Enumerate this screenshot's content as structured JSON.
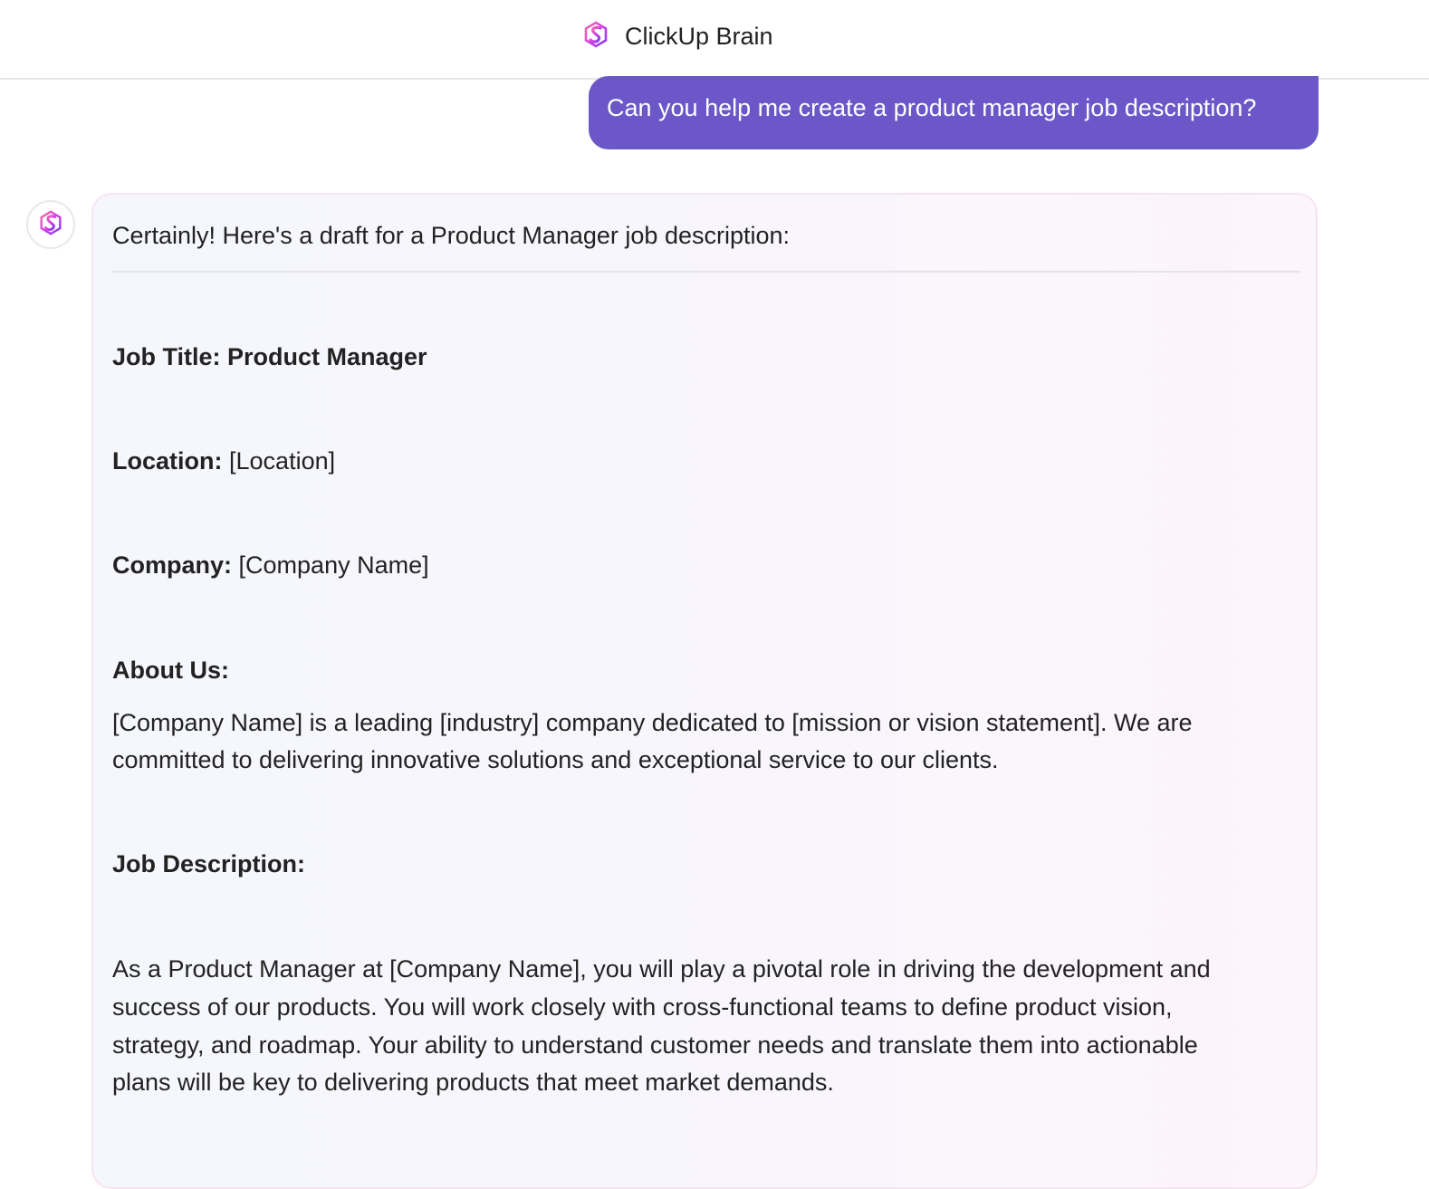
{
  "header": {
    "title": "ClickUp Brain",
    "icon": "brain-logo-icon"
  },
  "conversation": {
    "user_message": "Can you help me create a product manager job description?",
    "assistant": {
      "intro": "Certainly! Here's a draft for a Product Manager job description:",
      "job_title_label": "Job Title: Product Manager",
      "location_label": "Location:",
      "location_value": "[Location]",
      "company_label": "Company:",
      "company_value": "[Company Name]",
      "about_label": "About Us:",
      "about_lines": [
        "[Company Name] is a leading [industry] company dedicated to [mission or vision statement]. We are",
        "committed to delivering innovative solutions and exceptional service to our clients."
      ],
      "job_description_label": "Job Description:",
      "job_description_lines": [
        "As a Product Manager at [Company Name], you will play a pivotal role in driving the development and",
        "success of our products. You will work closely with cross-functional teams to define product vision,",
        "strategy, and roadmap. Your ability to understand customer needs and translate them into actionable",
        "plans will be key to delivering products that meet market demands."
      ]
    }
  },
  "colors": {
    "accent": "#6b57c7",
    "logo_pink": "#f04fa8",
    "logo_purple": "#9b3ff0"
  }
}
